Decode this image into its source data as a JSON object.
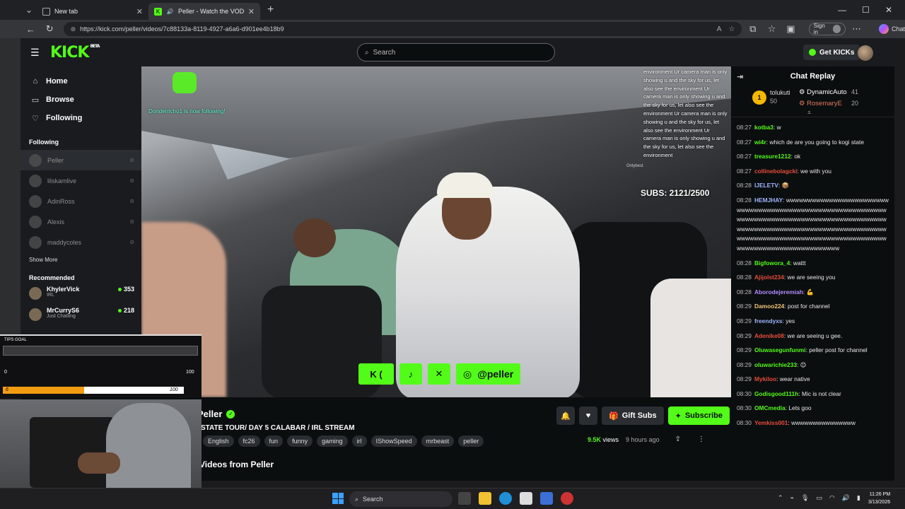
{
  "browser": {
    "tabs": [
      {
        "title": "New tab",
        "active": false
      },
      {
        "title": "Peller - Watch the VOD on Kick",
        "active": true
      }
    ],
    "url": "https://kick.com/peller/videos/7c88133a-8119-4927-a6a6-d901ee4b18b9",
    "signin_label": "Sign in",
    "chat_label": "Chat"
  },
  "header": {
    "logo": "KICK",
    "logo_badge": "BETA",
    "search_placeholder": "Search",
    "get_kicks_label": "Get KICKs"
  },
  "sidebar": {
    "nav": [
      {
        "label": "Home",
        "icon": "home-icon"
      },
      {
        "label": "Browse",
        "icon": "browse-icon"
      },
      {
        "label": "Following",
        "icon": "heart-icon"
      }
    ],
    "following_title": "Following",
    "following": [
      "Peller",
      "lilskamlive",
      "AdinRoss",
      "Alexis",
      "maddycoles"
    ],
    "show_more": "Show More",
    "recommended_title": "Recommended",
    "recommended": [
      {
        "name": "KhylerVick",
        "category": "IRL",
        "viewers": "353"
      },
      {
        "name": "MrCurryS6",
        "category": "Just Chatting",
        "viewers": "218"
      }
    ]
  },
  "video": {
    "follower_alert": "Donderricho1 is now following!",
    "overlay_chat": "environment Ur camera man is only showing u and the sky for us, let also see the environment Ur camera man is only showing u and the sky for us, let also see the environment Ur camera man is only showing u and the sky for us, let also see the environment Ur camera man is only showing u and the sky for us, let also see the environment",
    "onlybest_label": "Onlybest",
    "subs_counter": "SUBS: 2121/2500",
    "social_handle": "@peller"
  },
  "stream": {
    "streamer": "Peller",
    "title": "STATE TOUR/ DAY 5 CALABAR / IRL STREAM",
    "tags": [
      "English",
      "fc26",
      "fun",
      "funny",
      "gaming",
      "irl",
      "IShowSpeed",
      "mrbeast",
      "peller"
    ],
    "gift_subs_label": "Gift Subs",
    "subscribe_label": "Subscribe",
    "views": "9.5K",
    "views_label": "views",
    "time_ago": "9 hours ago",
    "videos_from": "Videos from Peller"
  },
  "overlay_goal": {
    "title": "TIPS GOAL",
    "min": "0",
    "max": "100",
    "sub_goal_current": "6",
    "sub_goal_max": "100",
    "sub_goal_progress": 0.45
  },
  "chat": {
    "title": "Chat Replay",
    "leaderboard": {
      "first": {
        "rank": "1",
        "name": "tolukuti",
        "value": "50"
      },
      "second": {
        "name": "DynamicAuto",
        "value": "41"
      },
      "third": {
        "name": "RosemaryE",
        "value": "20"
      }
    },
    "messages": [
      {
        "time": "08:27",
        "user": "kotba3",
        "color": "green",
        "text": "w"
      },
      {
        "time": "08:27",
        "user": "wi4r",
        "color": "green",
        "text": "which de are you going to kogi state"
      },
      {
        "time": "08:27",
        "user": "treasure1212",
        "color": "green",
        "text": "ok"
      },
      {
        "time": "08:27",
        "user": "collinebolagcki",
        "color": "red",
        "text": "we with you"
      },
      {
        "time": "08:28",
        "user": "IJELETV",
        "color": "blue",
        "text": "📦"
      },
      {
        "time": "08:28",
        "user": "HEMJHAY",
        "color": "blue",
        "text": "wwwwwwwwwwwwwwwwwwwwwwwwwwwwwwwwwwwwwwwwwwwwwwwwwwwwwwwwwwwwwwwwwwwwwwwwwwwwwwwwwwwwwwwwwwwwwwwwwwwwwwwwwwwwwwwwwwwwwwwwwwwwwwwwwwwwwwwwwwwwwwwwwwwwwwwwwwwwwwwwwwwwwwwwwwwwwwwwwwwwwwwwwwww"
      },
      {
        "time": "08:28",
        "user": "Bigfowora_4",
        "color": "green",
        "text": "wattt"
      },
      {
        "time": "08:28",
        "user": "Ajijolst234",
        "color": "red",
        "text": "we are seeing you"
      },
      {
        "time": "08:28",
        "user": "Aborodejeremiah",
        "color": "purple",
        "text": "💪"
      },
      {
        "time": "08:29",
        "user": "Damoo224",
        "color": "gold",
        "text": "post for channel"
      },
      {
        "time": "08:29",
        "user": "freendyxs",
        "color": "blue",
        "text": "yes"
      },
      {
        "time": "08:29",
        "user": "Adenike08",
        "color": "red",
        "text": "we are seeing u gee."
      },
      {
        "time": "08:29",
        "user": "Oluwasegunfunmi",
        "color": "green",
        "text": "peller post for channel"
      },
      {
        "time": "08:29",
        "user": "oluwarichie233",
        "color": "green",
        "text": "😊"
      },
      {
        "time": "08:29",
        "user": "Mykiloo",
        "color": "red",
        "text": "wear native"
      },
      {
        "time": "08:30",
        "user": "Godisgood111h",
        "color": "green",
        "text": "Mic is not clear"
      },
      {
        "time": "08:30",
        "user": "OMCmedia",
        "color": "green",
        "text": "Lets goo"
      },
      {
        "time": "08:30",
        "user": "Yemkiss001",
        "color": "red",
        "text": "wwwwwwwwwwwwwww"
      }
    ]
  },
  "taskbar": {
    "search_label": "Search",
    "time": "11:26 PM",
    "date": "3/13/2026"
  },
  "colors": {
    "kick_green": "#53fc18",
    "background": "#0b0e0f",
    "panel": "#191b1f"
  }
}
